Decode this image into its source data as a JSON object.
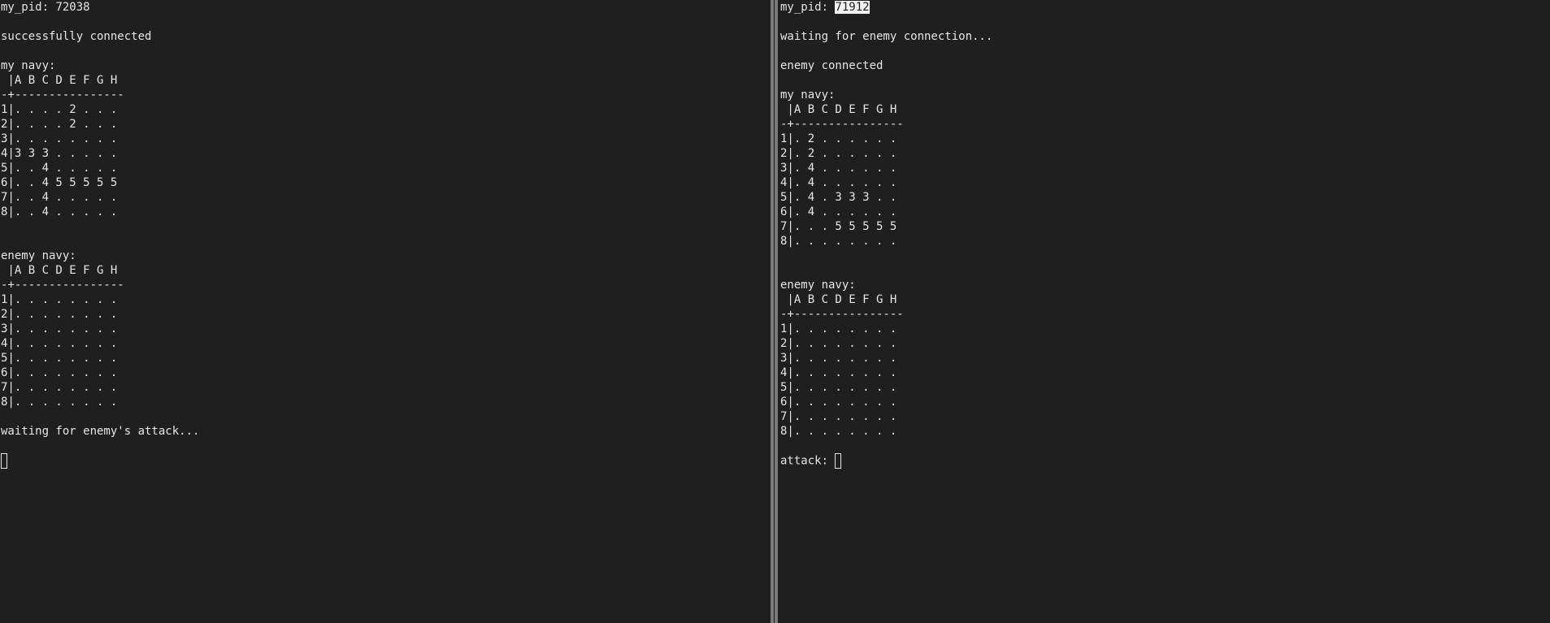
{
  "left": {
    "pid_prefix": "my_pid: ",
    "pid": "72038",
    "status": "successfully connected",
    "my_navy_label": "my navy:",
    "my_navy_grid": [
      " |A B C D E F G H",
      "-+----------------",
      "1|. . . . 2 . . .",
      "2|. . . . 2 . . .",
      "3|. . . . . . . .",
      "4|3 3 3 . . . . .",
      "5|. . 4 . . . . .",
      "6|. . 4 5 5 5 5 5",
      "7|. . 4 . . . . .",
      "8|. . 4 . . . . ."
    ],
    "enemy_navy_label": "enemy navy:",
    "enemy_navy_grid": [
      " |A B C D E F G H",
      "-+----------------",
      "1|. . . . . . . .",
      "2|. . . . . . . .",
      "3|. . . . . . . .",
      "4|. . . . . . . .",
      "5|. . . . . . . .",
      "6|. . . . . . . .",
      "7|. . . . . . . .",
      "8|. . . . . . . ."
    ],
    "prompt_text": "waiting for enemy's attack..."
  },
  "right": {
    "pid_prefix": "my_pid: ",
    "pid": "71912",
    "status_wait": "waiting for enemy connection...",
    "status_connected": "enemy connected",
    "my_navy_label": "my navy:",
    "my_navy_grid": [
      " |A B C D E F G H",
      "-+----------------",
      "1|. 2 . . . . . .",
      "2|. 2 . . . . . .",
      "3|. 4 . . . . . .",
      "4|. 4 . . . . . .",
      "5|. 4 . 3 3 3 . .",
      "6|. 4 . . . . . .",
      "7|. . . 5 5 5 5 5",
      "8|. . . . . . . ."
    ],
    "enemy_navy_label": "enemy navy:",
    "enemy_navy_grid": [
      " |A B C D E F G H",
      "-+----------------",
      "1|. . . . . . . .",
      "2|. . . . . . . .",
      "3|. . . . . . . .",
      "4|. . . . . . . .",
      "5|. . . . . . . .",
      "6|. . . . . . . .",
      "7|. . . . . . . .",
      "8|. . . . . . . ."
    ],
    "attack_prompt": "attack: "
  },
  "colors": {
    "background": "#1f1f1f",
    "text": "#e6e6e6",
    "divider": "#7a7a7a",
    "selection_bg": "#f2f2f2"
  }
}
